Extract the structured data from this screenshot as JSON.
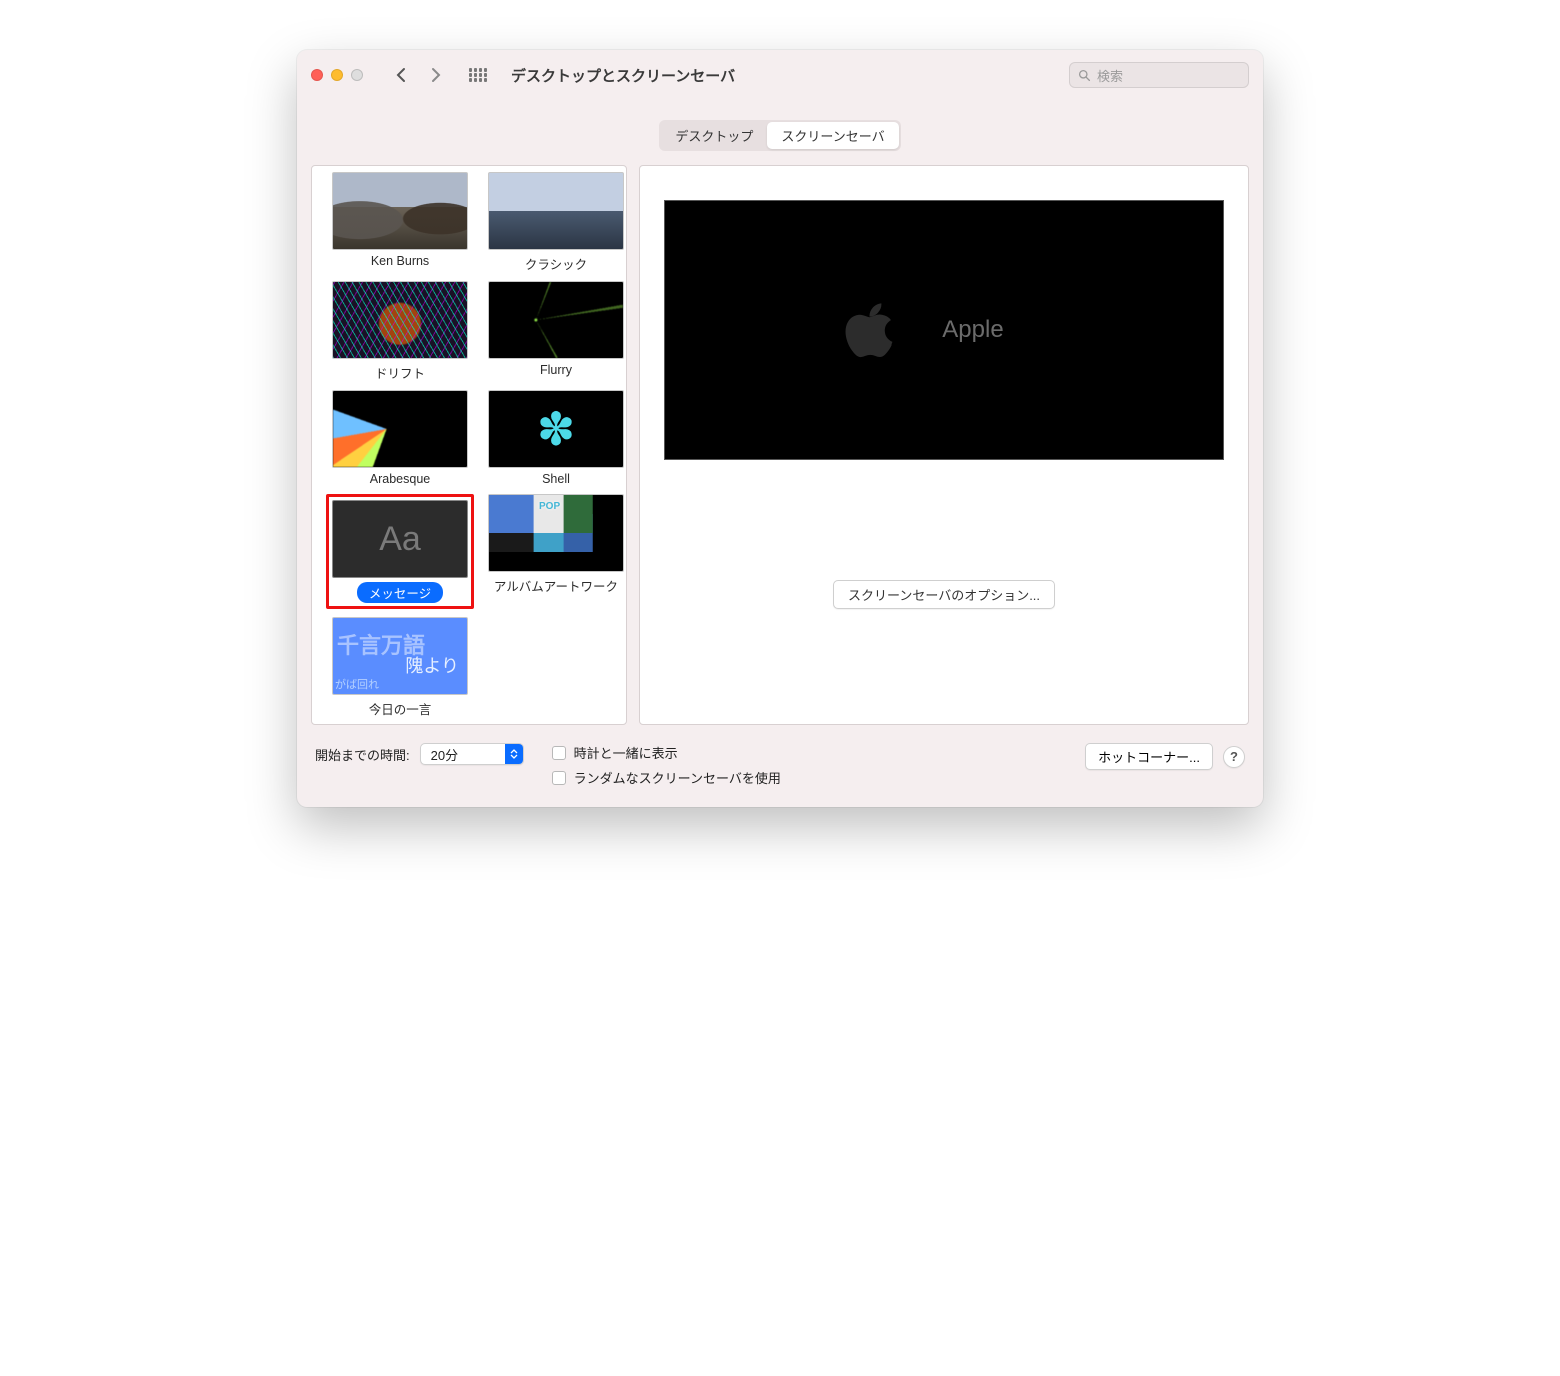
{
  "titlebar": {
    "title": "デスクトップとスクリーンセーバ",
    "search_placeholder": "検索"
  },
  "tabs": {
    "desktop": "デスクトップ",
    "screensaver": "スクリーンセーバ",
    "active": "screensaver"
  },
  "screensavers": {
    "ken_burns": "Ken Burns",
    "classic": "クラシック",
    "drift": "ドリフト",
    "flurry": "Flurry",
    "arabesque": "Arabesque",
    "shell": "Shell",
    "message": "メッセージ",
    "album": "アルバムアートワーク",
    "quote": "今日の一言",
    "selected": "message"
  },
  "thumb_text": {
    "msg": "Aa",
    "quote_top": "千言万語",
    "quote_mid": "隗より",
    "quote_bot": "がば回れ"
  },
  "preview": {
    "text": "Apple",
    "options_button": "スクリーンセーバのオプション..."
  },
  "footer": {
    "start_label": "開始までの時間:",
    "start_value": "20分",
    "clock_checkbox": "時計と一緒に表示",
    "random_checkbox": "ランダムなスクリーンセーバを使用",
    "hot_corners": "ホットコーナー...",
    "help": "?"
  }
}
